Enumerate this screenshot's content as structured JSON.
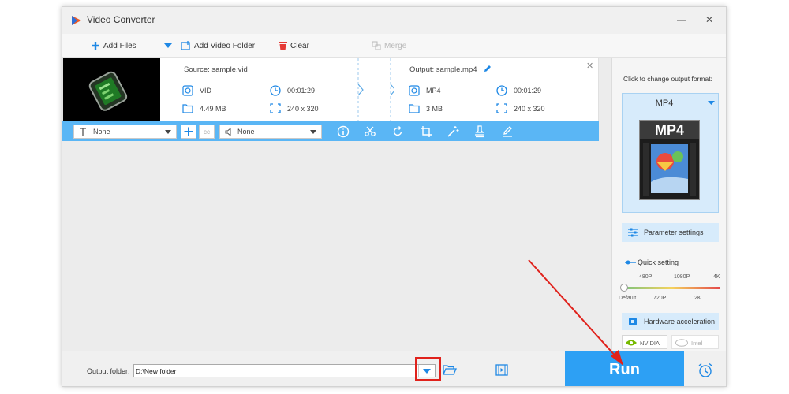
{
  "window": {
    "title": "Video Converter",
    "minimize_glyph": "—",
    "close_glyph": "✕"
  },
  "toolbar": {
    "add_files": "Add Files",
    "add_video_folder": "Add Video Folder",
    "clear": "Clear",
    "merge": "Merge"
  },
  "file": {
    "source_label": "Source: sample.vid",
    "source_format": "VID",
    "source_duration": "00:01:29",
    "source_size": "4.49 MB",
    "source_resolution": "240 x 320",
    "output_label": "Output: sample.mp4",
    "output_format": "MP4",
    "output_duration": "00:01:29",
    "output_size": "3 MB",
    "output_resolution": "240 x 320"
  },
  "edit_bar": {
    "subtitle_value": "None",
    "audio_value": "None"
  },
  "sidebar": {
    "change_format_label": "Click to change output format:",
    "format_name": "MP4",
    "format_badge": "MP4",
    "parameter_settings": "Parameter settings",
    "quick_setting": "Quick setting",
    "quality_top": [
      "480P",
      "1080P",
      "4K"
    ],
    "quality_bottom": [
      "Default",
      "720P",
      "2K"
    ],
    "hardware_acceleration": "Hardware acceleration",
    "nvidia": "NVIDIA",
    "intel": "Intel"
  },
  "bottom": {
    "output_folder_label": "Output folder:",
    "output_folder_value": "D:\\New folder",
    "run": "Run"
  },
  "colors": {
    "accent": "#2da0f4",
    "edit_bar": "#5ab6f5",
    "annotation": "#e0221c",
    "nvidia_green": "#76b900"
  }
}
